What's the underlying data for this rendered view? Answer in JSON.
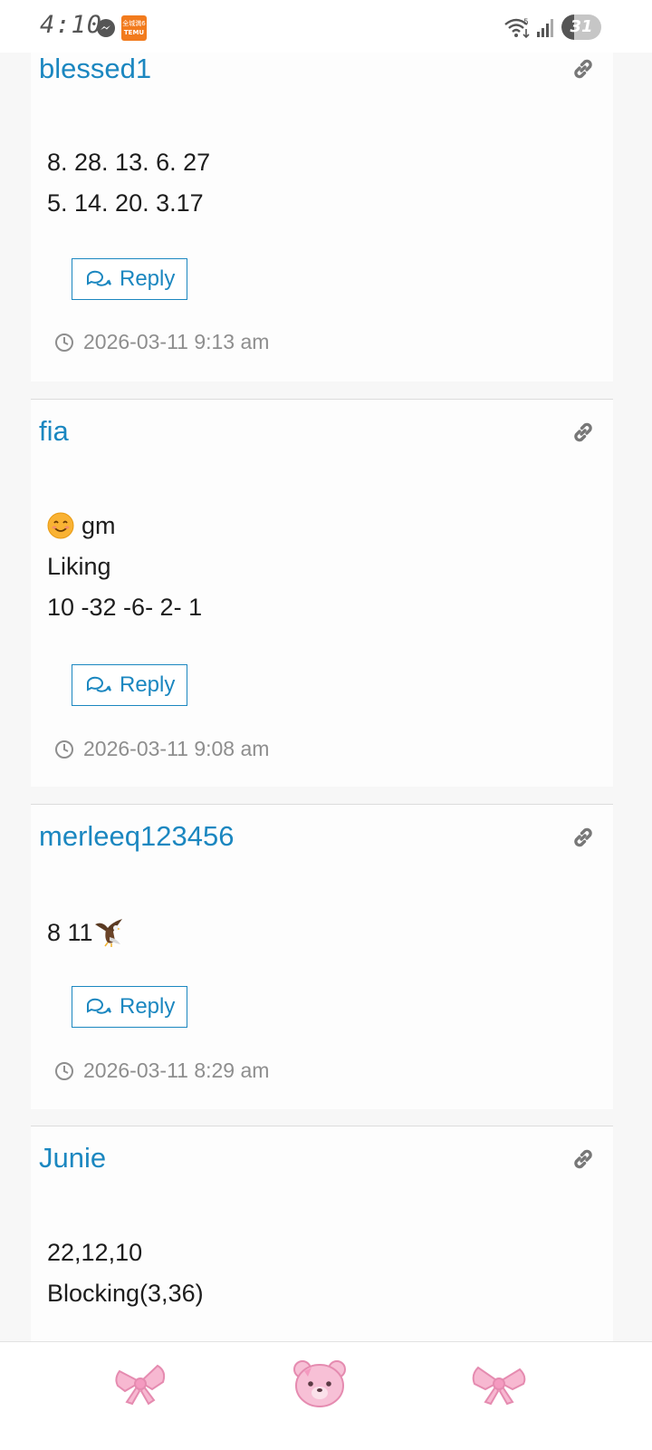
{
  "status_bar": {
    "time": "4:10",
    "battery_level": "31",
    "battery_fraction": 0.31,
    "icons": [
      "messenger-icon",
      "temu-icon",
      "wifi-icon",
      "signal-icon",
      "battery-icon"
    ],
    "temu_text_top": "全城満6",
    "temu_text_bottom": "TEMU"
  },
  "comments": [
    {
      "author": "blessed1",
      "lines": [
        "8. 28. 13. 6. 27",
        "5. 14. 20. 3.17"
      ],
      "reply_label": "Reply",
      "timestamp": "2026-03-11 9:13 am"
    },
    {
      "author": "fia",
      "lines": [
        "gm",
        "Liking",
        "10 -32 -6- 2- 1"
      ],
      "leading_emoji": "smiling-face-emoji",
      "reply_label": "Reply",
      "timestamp": "2026-03-11 9:08 am"
    },
    {
      "author": "merleeq123456",
      "lines": [
        "8 11"
      ],
      "trailing_emoji": "eagle-emoji",
      "reply_label": "Reply",
      "timestamp": "2026-03-11 8:29 am"
    },
    {
      "author": "Junie",
      "lines": [
        "22,12,10",
        "Blocking(3,36)"
      ]
    }
  ],
  "bottom_nav": {
    "items": [
      "pink-bow-icon",
      "pink-bear-icon",
      "pink-bow-icon"
    ]
  },
  "colors": {
    "link_blue": "#1b87c0",
    "timestamp_gray": "#8e8e8e",
    "card_bg": "#fdfdfd",
    "page_bg": "#f7f7f7",
    "nav_pink": "#f7b8d1"
  }
}
